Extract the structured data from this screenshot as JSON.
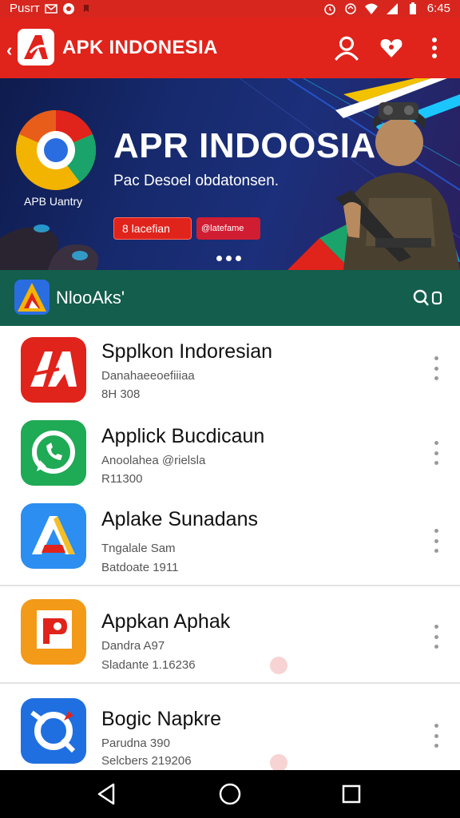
{
  "status_bar": {
    "carrier": "Pusrт",
    "time": "6:45",
    "icons": [
      "mail-icon",
      "record-icon",
      "notification-icon",
      "alarm-icon",
      "data-saver-icon",
      "wifi-icon",
      "signal-icon",
      "battery-icon"
    ]
  },
  "app_bar": {
    "title": "APK INDONESIA",
    "icons": [
      "back-chevron-icon",
      "account-icon",
      "heart-icon",
      "more-vert-icon"
    ]
  },
  "banner": {
    "title": "APR INDOOSIA",
    "subtitle": "Pac Desoel obdatonsen.",
    "logo_label": "APB Uantry",
    "button_primary": "8 lacefian",
    "button_secondary": "@latefame",
    "page_indicator_count": 3
  },
  "section": {
    "title": "NlooAks'",
    "icons": [
      "category-logo-icon",
      "search-icon"
    ]
  },
  "apps": [
    {
      "name": "Spplkon Indoresian",
      "subtitle": "Danahaeeoefiiiaa",
      "meta": "8H 308",
      "icon": "red-a-logo-icon"
    },
    {
      "name": "Applick Bucdicaun",
      "subtitle": "Anoolahea @rielsla",
      "meta": "R11300",
      "icon": "whatsapp-style-icon"
    },
    {
      "name": "Aplake Sunadans",
      "subtitle": "Tngalale Sam",
      "meta": "Batdoate 1911",
      "icon": "triangle-a-icon"
    },
    {
      "name": "Appkan Aphak",
      "subtitle": "Dandra A97",
      "meta": "Sladante 1.16236",
      "icon": "orange-p-icon",
      "badge": true
    },
    {
      "name": "Bogic Napkre",
      "subtitle": "Parudna 390",
      "meta": "Selcbers 219206",
      "icon": "blue-compass-icon",
      "badge": true
    }
  ],
  "colors": {
    "status_bar": "#d7261e",
    "app_bar": "#e0231b",
    "section_header": "#135e4c",
    "nav_bar": "#000000"
  },
  "nav_bar": {
    "icons": [
      "back-triangle-icon",
      "home-circle-icon",
      "recents-square-icon"
    ]
  }
}
